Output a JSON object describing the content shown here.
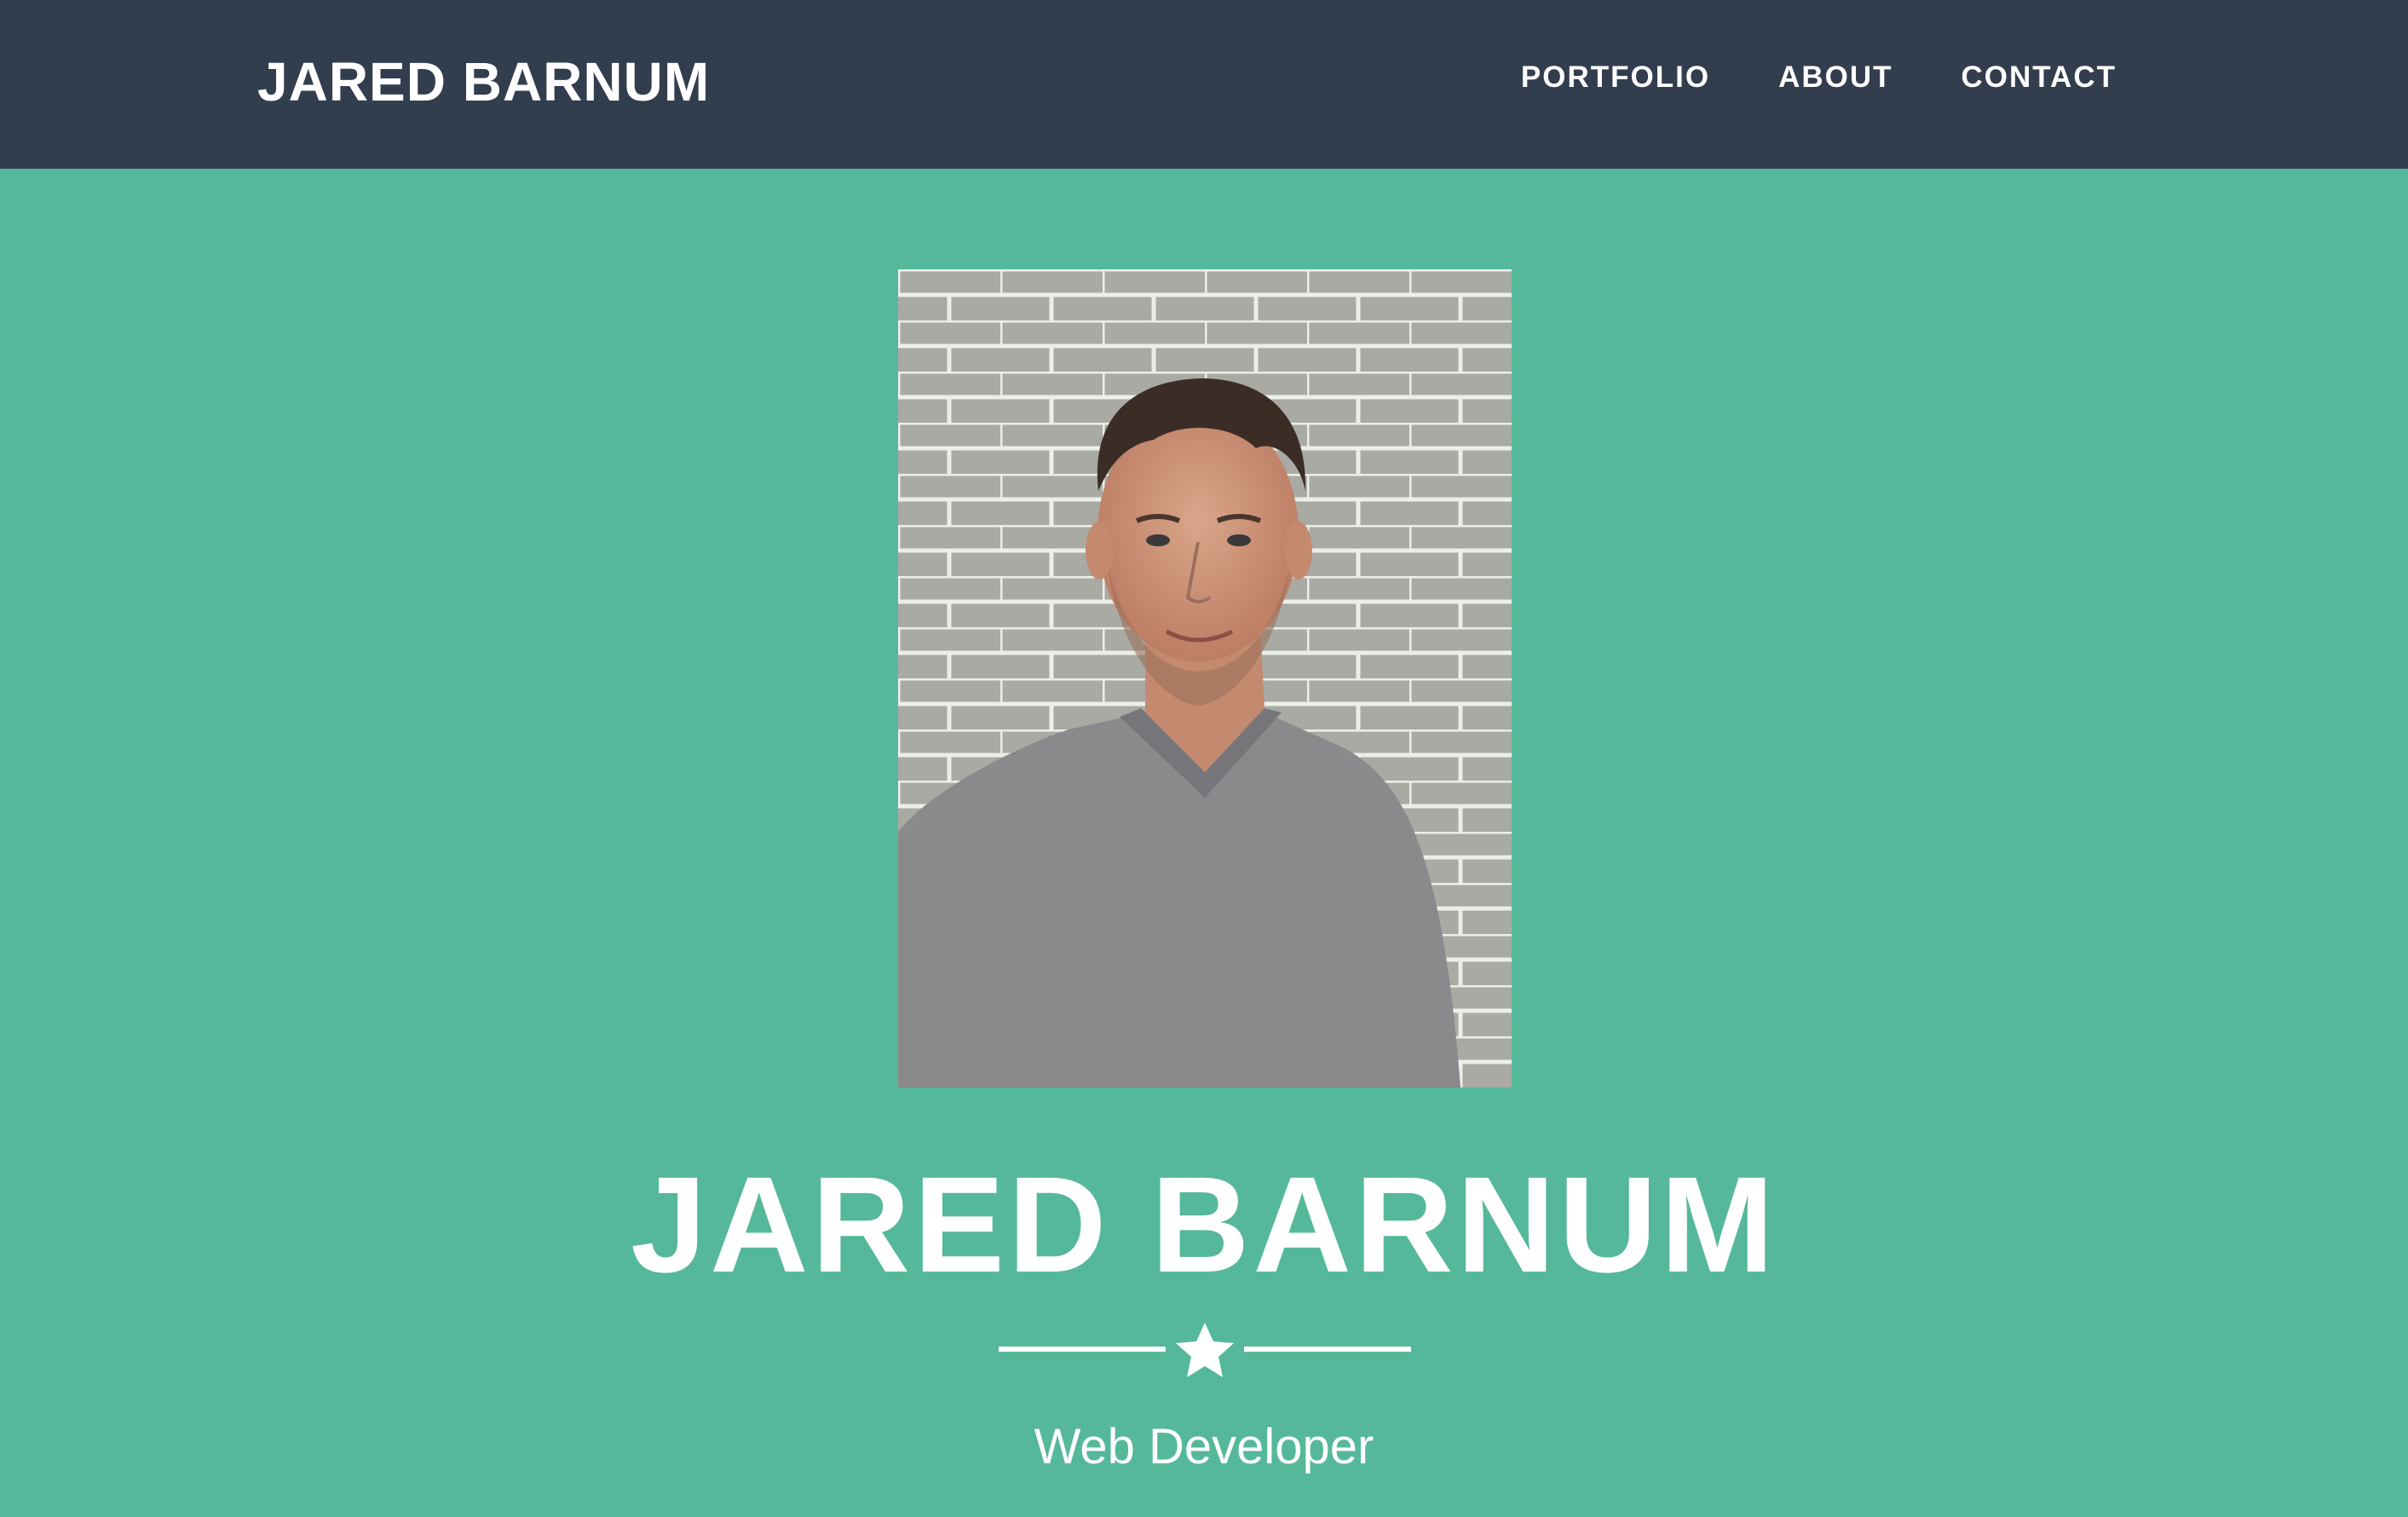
{
  "navbar": {
    "brand": "JARED BARNUM",
    "links": [
      {
        "label": "PORTFOLIO"
      },
      {
        "label": "ABOUT"
      },
      {
        "label": "CONTACT"
      }
    ]
  },
  "hero": {
    "name": "JARED BARNUM",
    "divider_icon": "star-icon",
    "subtitle": "Web Developer",
    "photo_icon": "profile-photo"
  },
  "colors": {
    "navbar_bg": "#323d4e",
    "hero_bg": "#55b89b",
    "text": "#ffffff"
  }
}
